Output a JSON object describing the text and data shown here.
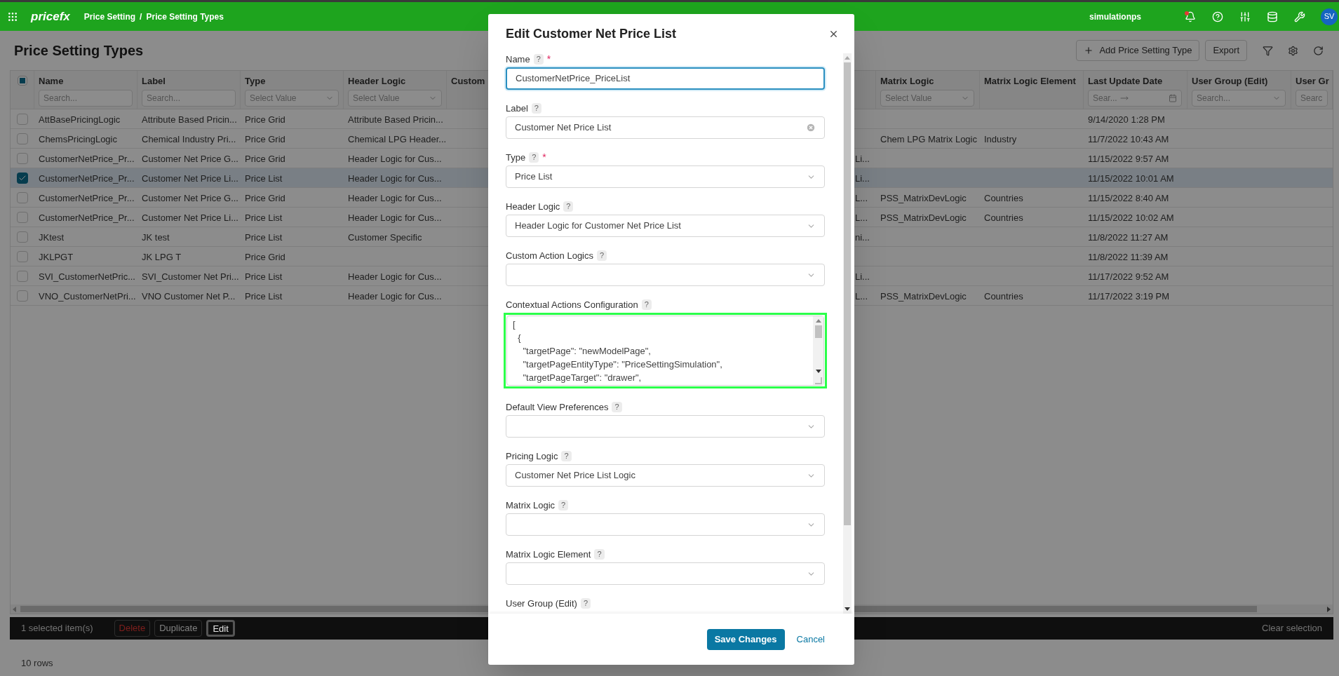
{
  "top_bar": {
    "logo": "pricefx",
    "breadcrumb": [
      "Price Setting",
      "Price Setting Types"
    ],
    "breadcrumb_separator": "/",
    "user": "simulationps",
    "avatar": "SV",
    "notification_dot": true
  },
  "page": {
    "title": "Price Setting Types",
    "buttons": [
      {
        "label": "Add Price Setting Type",
        "kind": "add"
      },
      {
        "label": "Export",
        "kind": "plain"
      }
    ]
  },
  "table": {
    "select_all": {
      "checked": true,
      "indeterminate": true
    },
    "columns": [
      {
        "label": "Name",
        "filter": {
          "kind": "search",
          "placeholder": "Search..."
        }
      },
      {
        "label": "Label",
        "filter": {
          "kind": "search",
          "placeholder": "Search..."
        }
      },
      {
        "label": "Type",
        "filter": {
          "kind": "select",
          "placeholder": "Select Value"
        }
      },
      {
        "label": "Header Logic",
        "filter": {
          "kind": "select",
          "placeholder": "Select Value"
        }
      },
      {
        "label": "Custom"
      },
      {},
      {
        "label": "Matrix Logic",
        "filter": {
          "kind": "select",
          "placeholder": "Select Value"
        }
      },
      {
        "label": "Matrix Logic Element"
      },
      {
        "label": "Last Update Date",
        "filter": {
          "kind": "date_range",
          "placeholder": "Sear..."
        }
      },
      {
        "label": "User Group (Edit)",
        "filter": {
          "kind": "select",
          "placeholder": "Search..."
        }
      },
      {
        "label": "User Gr",
        "filter": {
          "kind": "search",
          "placeholder": "Searc"
        }
      }
    ],
    "rows": [
      {
        "selected": false,
        "cells": [
          "AttBasePricingLogic",
          "Attribute Based Pricin...",
          "Price Grid",
          "Attribute Based Pricin...",
          null,
          null,
          null,
          null,
          "9/14/2020 1:28 PM"
        ]
      },
      {
        "selected": false,
        "cells": [
          "ChemsPricingLogic",
          "Chemical Industry Pri...",
          "Price Grid",
          "Chemical LPG Header...",
          null,
          null,
          "Chem LPG Matrix Logic",
          "Industry",
          "11/7/2022 10:43 AM"
        ]
      },
      {
        "selected": false,
        "cells": [
          "CustomerNetPrice_Pr...",
          "Customer Net Price G...",
          "Price Grid",
          "Header Logic for Cus...",
          null,
          "Li...",
          null,
          null,
          "11/15/2022 9:57 AM"
        ]
      },
      {
        "selected": true,
        "cells": [
          "CustomerNetPrice_Pr...",
          "Customer Net Price Li...",
          "Price List",
          "Header Logic for Cus...",
          null,
          "Li...",
          null,
          null,
          "11/15/2022 10:01 AM"
        ]
      },
      {
        "selected": false,
        "cells": [
          "CustomerNetPrice_Pr...",
          "Customer Net Price G...",
          "Price Grid",
          "Header Logic for Cus...",
          null,
          "L...",
          "PSS_MatrixDevLogic",
          "Countries",
          "11/15/2022 8:40 AM"
        ]
      },
      {
        "selected": false,
        "cells": [
          "CustomerNetPrice_Pr...",
          "Customer Net Price Li...",
          "Price List",
          "Header Logic for Cus...",
          null,
          "L...",
          "PSS_MatrixDevLogic",
          "Countries",
          "11/15/2022 10:02 AM"
        ]
      },
      {
        "selected": false,
        "cells": [
          "JKtest",
          "JK test",
          "Price List",
          "Customer Specific",
          null,
          "ni...",
          null,
          null,
          "11/8/2022 11:27 AM"
        ]
      },
      {
        "selected": false,
        "cells": [
          "JKLPGT",
          "JK LPG T",
          "Price Grid",
          null,
          null,
          null,
          null,
          null,
          "11/8/2022 11:39 AM"
        ]
      },
      {
        "selected": false,
        "cells": [
          "SVI_CustomerNetPric...",
          "SVI_Customer Net Pri...",
          "Price List",
          "Header Logic for Cus...",
          null,
          "Li...",
          null,
          null,
          "11/17/2022 9:52 AM"
        ]
      },
      {
        "selected": false,
        "cells": [
          "VNO_CustomerNetPri...",
          "VNO Customer Net P...",
          "Price List",
          "Header Logic for Cus...",
          null,
          "L...",
          "PSS_MatrixDevLogic",
          "Countries",
          "11/17/2022 3:19 PM"
        ]
      }
    ],
    "footer": "10 rows"
  },
  "selection_bar": {
    "count": "1 selected item(s)",
    "actions": [
      {
        "label": "Delete",
        "kind": "danger",
        "highlighted": false
      },
      {
        "label": "Duplicate",
        "kind": "plain",
        "highlighted": false
      },
      {
        "label": "Edit",
        "kind": "plain",
        "highlighted": true
      }
    ],
    "clear": "Clear selection"
  },
  "dialog": {
    "title": "Edit Customer Net Price List",
    "required_mark": "*",
    "fields": [
      {
        "label": "Name",
        "help": "?",
        "required": true,
        "kind": "text",
        "value": "CustomerNetPrice_PriceList",
        "focused": true,
        "clearable": false
      },
      {
        "label": "Label",
        "help": "?",
        "required": false,
        "kind": "text",
        "value": "Customer Net Price List",
        "focused": false,
        "clearable": true
      },
      {
        "label": "Type",
        "help": "?",
        "required": true,
        "kind": "select",
        "value": "Price List"
      },
      {
        "label": "Header Logic",
        "help": "?",
        "required": false,
        "kind": "select",
        "value": "Header Logic for Customer Net Price List"
      },
      {
        "label": "Custom Action Logics",
        "help": "?",
        "required": false,
        "kind": "select"
      },
      {
        "label": "Contextual Actions Configuration",
        "help": "?",
        "required": false,
        "kind": "code",
        "highlighted": true,
        "lines": [
          "[",
          "  {",
          "    \"targetPage\": \"newModelPage\",",
          "    \"targetPageEntityType\": \"PriceSettingSimulation\",",
          "    \"targetPageTarget\": \"drawer\","
        ]
      },
      {
        "label": "Default View Preferences",
        "help": "?",
        "required": false,
        "kind": "select"
      },
      {
        "label": "Pricing Logic",
        "help": "?",
        "required": false,
        "kind": "select",
        "value": "Customer Net Price List Logic"
      },
      {
        "label": "Matrix Logic",
        "help": "?",
        "required": false,
        "kind": "select"
      },
      {
        "label": "Matrix Logic Element",
        "help": "?",
        "required": false,
        "kind": "select"
      },
      {
        "label": "User Group (Edit)",
        "help": "?",
        "required": false,
        "kind": "label_only"
      }
    ],
    "buttons": [
      {
        "label": "Save Changes",
        "kind": "primary"
      },
      {
        "label": "Cancel",
        "kind": "link"
      }
    ]
  }
}
